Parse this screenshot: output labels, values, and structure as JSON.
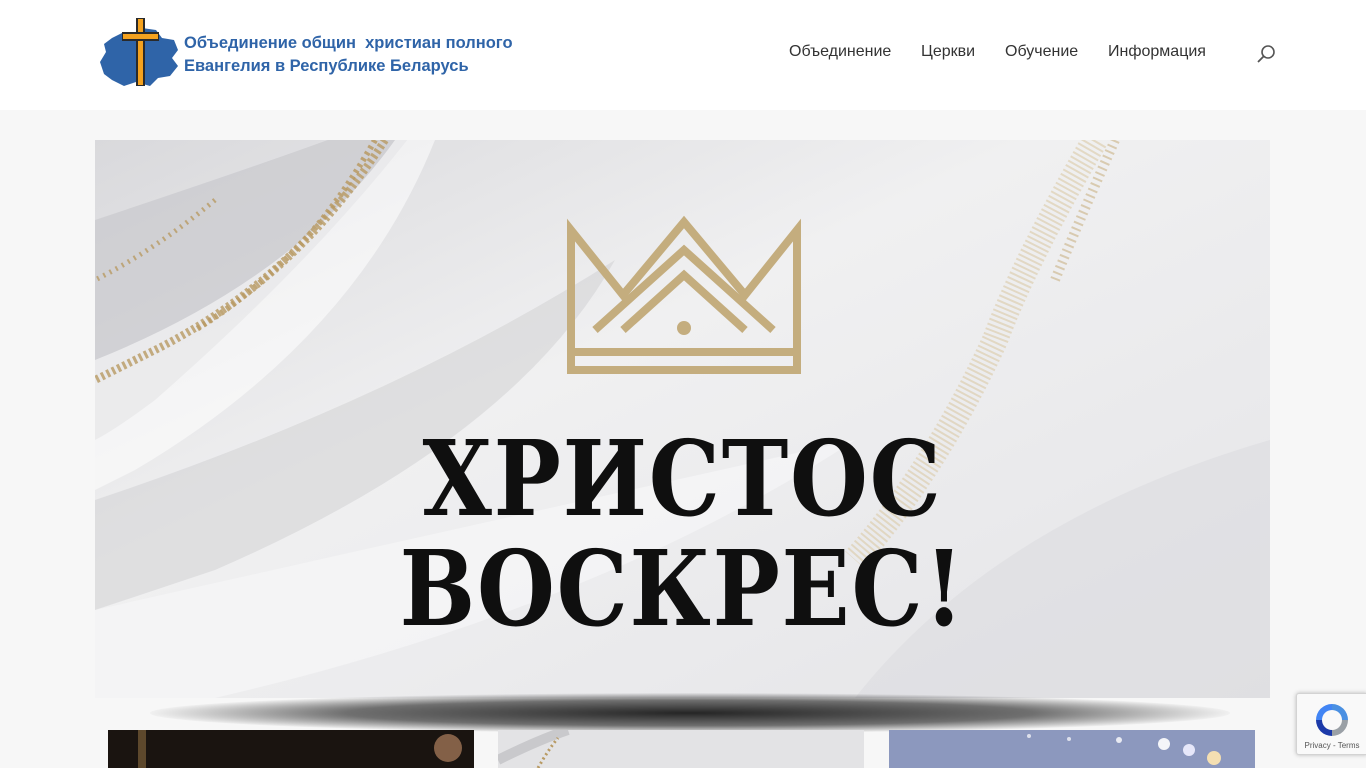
{
  "header": {
    "logo_line1": "Объединение общин  христиан полного",
    "logo_line2": "Евангелия в Республике Беларусь",
    "nav": [
      "Объединение",
      "Церкви",
      "Обучение",
      "Информация"
    ],
    "search_icon": "search-icon"
  },
  "hero": {
    "line1": "ХРИСТОС",
    "line2": "ВОСКРЕС!",
    "crown_icon": "crown-icon",
    "accent_color": "#c4ad7e"
  },
  "recaptcha": {
    "privacy": "Privacy",
    "separator": " - ",
    "terms": "Terms"
  },
  "colors": {
    "brand_blue": "#2f64a8",
    "cross_orange": "#f4a21f",
    "nav_text": "#333333"
  }
}
